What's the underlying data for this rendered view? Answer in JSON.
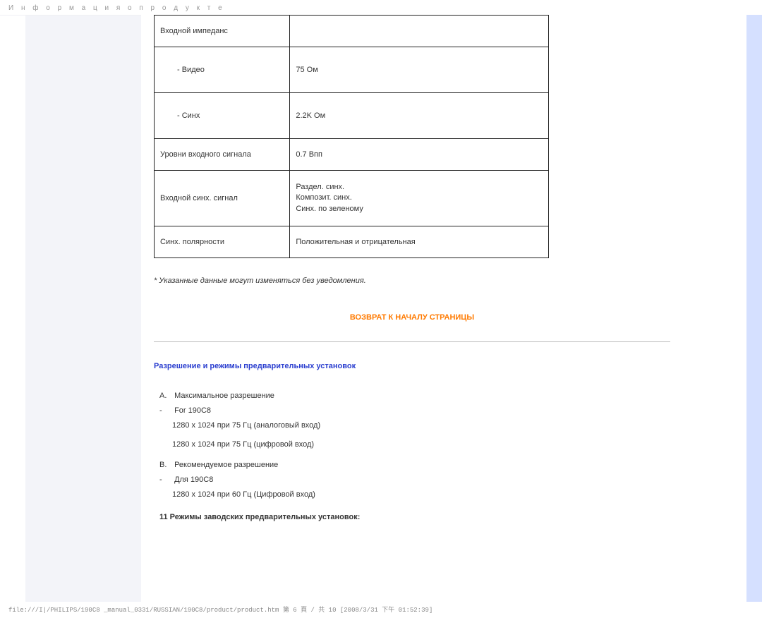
{
  "header": {
    "title": "И н ф о р м а ц и я о п р о д у к т е"
  },
  "table": {
    "r0": {
      "label": "Входной импеданс"
    },
    "r1": {
      "label": "- Видео",
      "value": "75 Ом"
    },
    "r2": {
      "label": "- Синх",
      "value": "2.2K Ом"
    },
    "r3": {
      "label": "Уровни входного сигнала",
      "value": "0.7 Впп"
    },
    "r4": {
      "label": "Входной синх. сигнал",
      "value": "Раздел. синх.\nКомпозит. синх.\nСинх. по зеленому"
    },
    "r5": {
      "label": "Синх. полярности",
      "value": "Положительная и отрицательная"
    }
  },
  "note": "* Указанные данные могут изменяться без уведомления.",
  "return_link": "ВОЗВРАТ К НАЧАЛУ СТРАНИЦЫ",
  "resolution": {
    "title": "Разрешение и режимы предварительных установок",
    "A": {
      "tag": "A.",
      "label": "Максимальное разрешение",
      "for_tag": "-",
      "for_label": "For 190C8",
      "line1": "1280 x 1024 при 75 Гц (аналоговый вход)",
      "line2": "1280 x 1024 при 75 Гц (цифровой вход)"
    },
    "B": {
      "tag": "B.",
      "label": "Рекомендуемое разрешение",
      "for_tag": "-",
      "for_label": "Для 190C8",
      "line1": "1280 x 1024 при 60 Гц (Цифровой вход)"
    },
    "factory": "11 Режимы заводских предварительных установок:"
  },
  "footer": "file:///I|/PHILIPS/190C8 _manual_0331/RUSSIAN/190C8/product/product.htm 第 6 頁 / 共 10 [2008/3/31 下午 01:52:39]"
}
